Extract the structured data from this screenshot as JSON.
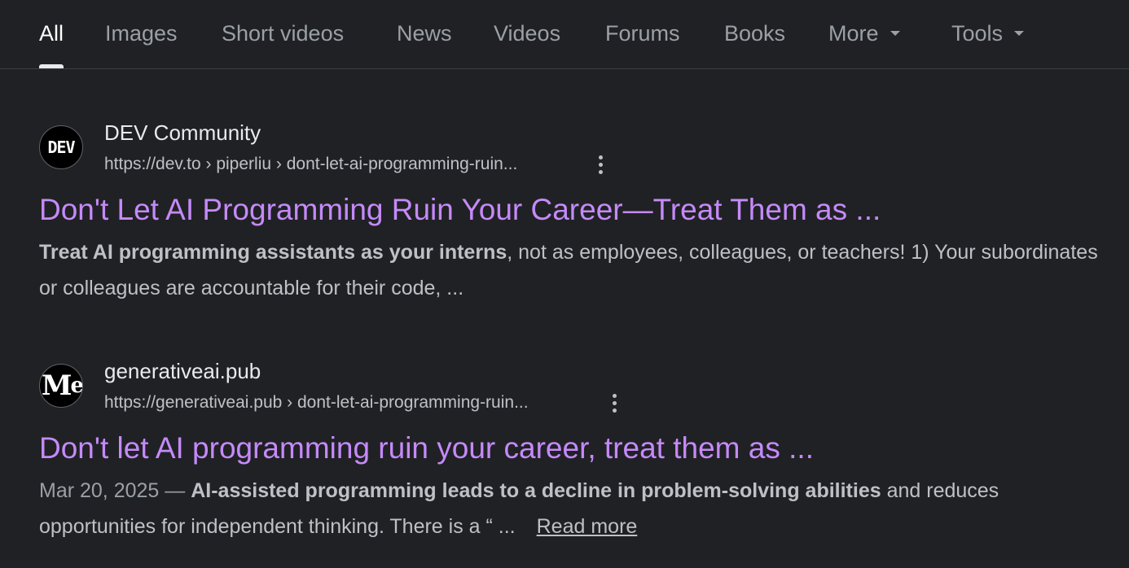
{
  "tabs": [
    {
      "label": "All",
      "active": true
    },
    {
      "label": "Images"
    },
    {
      "label": "Short videos"
    },
    {
      "label": "News"
    },
    {
      "label": "Videos"
    },
    {
      "label": "Forums"
    },
    {
      "label": "Books"
    },
    {
      "label": "More",
      "dropdown": true
    },
    {
      "label": "Tools",
      "dropdown": true
    }
  ],
  "results": [
    {
      "favicon_text": "DEV",
      "site_name": "DEV Community",
      "url": "https://dev.to › piperliu › dont-let-ai-programming-ruin...",
      "title": "Don't Let AI Programming Ruin Your Career—Treat Them as ...",
      "snippet_bold": "Treat AI programming assistants as your interns",
      "snippet_rest": ", not as employees, colleagues, or teachers! 1) Your subordinates or colleagues are accountable for their code, ..."
    },
    {
      "favicon_text": "M",
      "site_name": "generativeai.pub",
      "url": "https://generativeai.pub › dont-let-ai-programming-ruin...",
      "title": "Don't let AI programming ruin your career, treat them as ...",
      "date": "Mar 20, 2025 — ",
      "snippet_bold": "AI-assisted programming leads to a decline in problem-solving abilities",
      "snippet_rest": " and reduces opportunities for independent thinking. There is a “ ...",
      "read_more": "Read more"
    }
  ],
  "colors": {
    "background": "#202124",
    "visited_link": "#c58af9",
    "text_secondary": "#bdc1c6"
  },
  "icons": {
    "more_dropdown": "chevron-down-icon",
    "result_menu": "kebab-menu-icon"
  }
}
